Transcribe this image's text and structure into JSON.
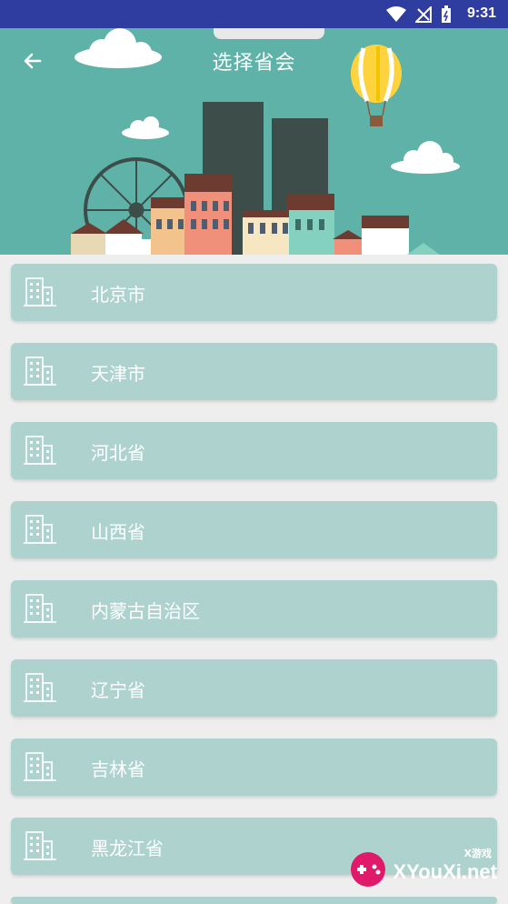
{
  "status_bar": {
    "time": "9:31",
    "icons": [
      "wifi-icon",
      "signal-icon",
      "battery-icon"
    ]
  },
  "header": {
    "title": "选择省会",
    "back_icon": "arrow-left-icon"
  },
  "provinces": [
    {
      "label": "北京市",
      "icon": "building-icon"
    },
    {
      "label": "天津市",
      "icon": "building-icon"
    },
    {
      "label": "河北省",
      "icon": "building-icon"
    },
    {
      "label": "山西省",
      "icon": "building-icon"
    },
    {
      "label": "内蒙古自治区",
      "icon": "building-icon"
    },
    {
      "label": "辽宁省",
      "icon": "building-icon"
    },
    {
      "label": "吉林省",
      "icon": "building-icon"
    },
    {
      "label": "黑龙江省",
      "icon": "building-icon"
    }
  ],
  "watermark": {
    "brand": "XYouXi.net",
    "tag": "X游戏"
  },
  "colors": {
    "status_bar": "#2f3ca0",
    "header_bg": "#5fb2a7",
    "item_bg": "#aed3cf",
    "page_bg": "#eeeeee"
  }
}
